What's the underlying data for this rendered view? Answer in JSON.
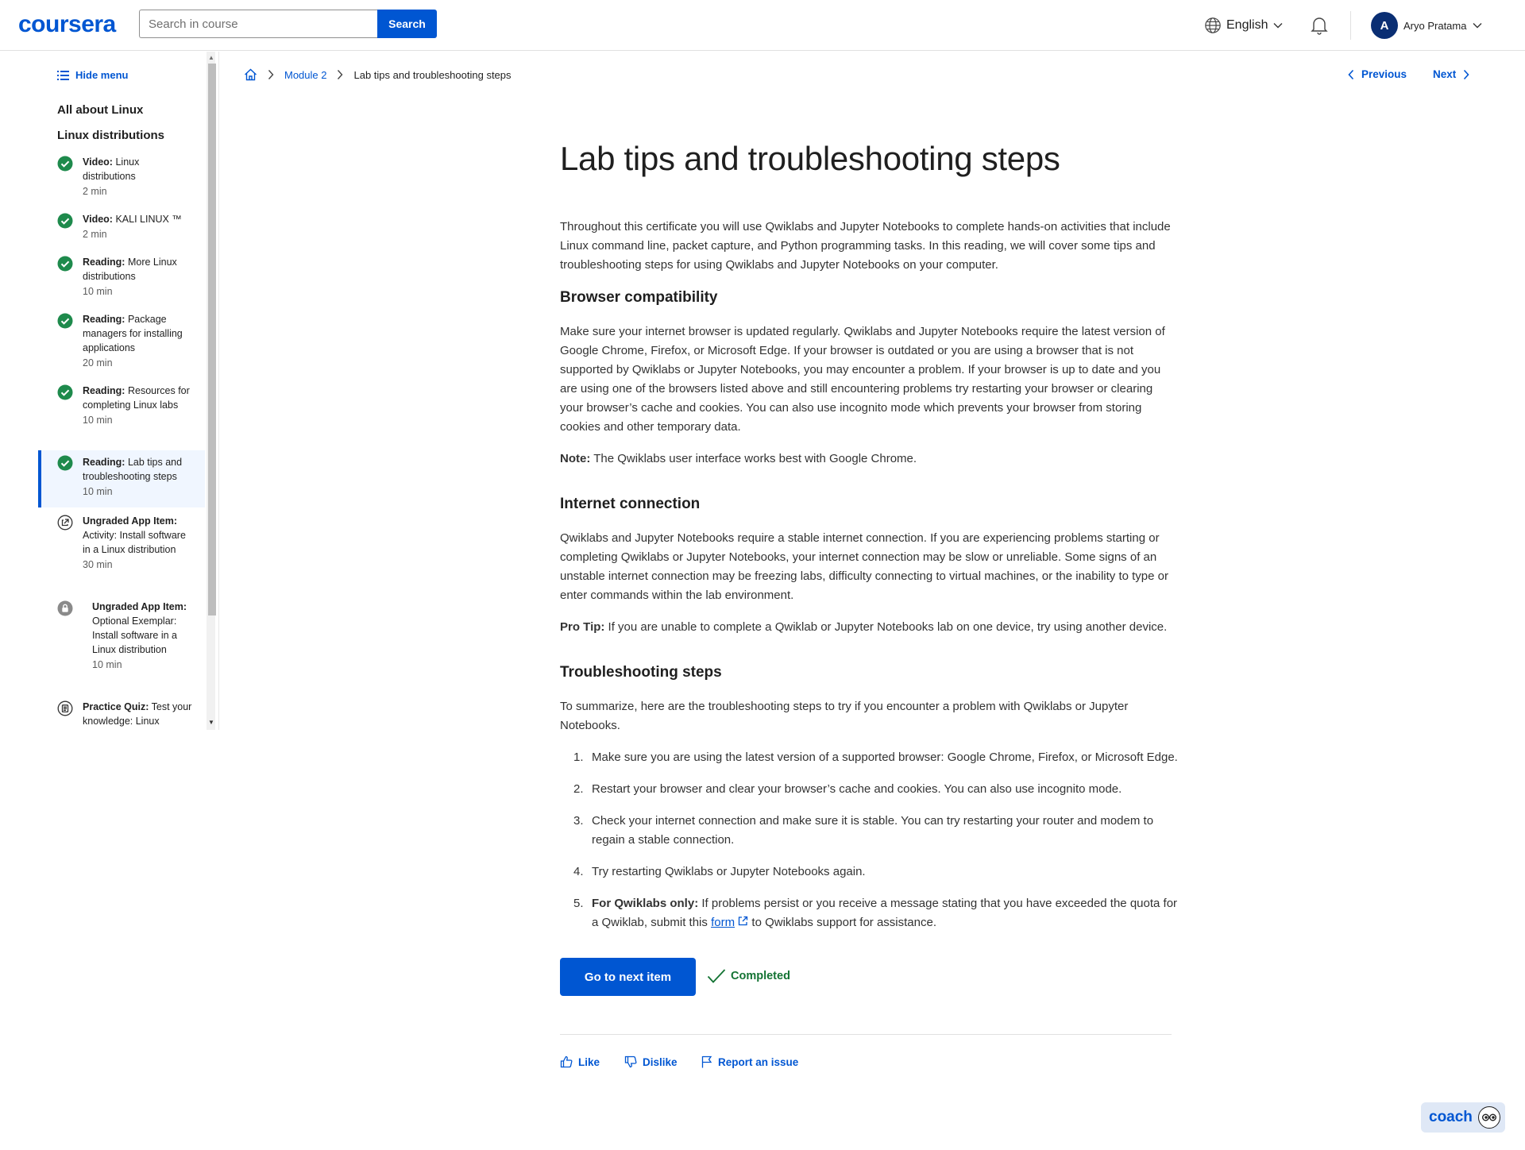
{
  "header": {
    "logo": "coursera",
    "search_placeholder": "Search in course",
    "search_button": "Search",
    "language": "English",
    "user_initial": "A",
    "user_name": "Aryo Pratama"
  },
  "sidebar": {
    "hide_menu": "Hide menu",
    "lesson_titles": [
      "All about Linux",
      "Linux distributions"
    ],
    "items": [
      {
        "type": "Video:",
        "name": "Linux distributions",
        "duration": "2 min",
        "status": "completed"
      },
      {
        "type": "Video:",
        "name": "KALI LINUX ™",
        "duration": "2 min",
        "status": "completed"
      },
      {
        "type": "Reading:",
        "name": "More Linux distributions",
        "duration": "10 min",
        "status": "completed"
      },
      {
        "type": "Reading:",
        "name": "Package managers for installing applications",
        "duration": "20 min",
        "status": "completed"
      },
      {
        "type": "Reading:",
        "name": "Resources for completing Linux labs",
        "duration": "10 min",
        "status": "completed"
      },
      {
        "type": "Reading:",
        "name": "Lab tips and troubleshooting steps",
        "duration": "10 min",
        "status": "completed",
        "active": true
      },
      {
        "type": "Ungraded App Item:",
        "name": "Activity: Install software in a Linux distribution",
        "duration": "30 min",
        "status": "app"
      },
      {
        "type": "Ungraded App Item:",
        "name": "Optional Exemplar: Install software in a Linux distribution",
        "duration": "10 min",
        "status": "locked"
      },
      {
        "type": "Practice Quiz:",
        "name": "Test your knowledge: Linux",
        "duration": "",
        "status": "quiz"
      }
    ]
  },
  "breadcrumb": {
    "module": "Module 2",
    "current": "Lab tips and troubleshooting steps"
  },
  "nav": {
    "previous": "Previous",
    "next": "Next"
  },
  "content": {
    "title": "Lab tips and troubleshooting steps",
    "intro": "Throughout this certificate you will use Qwiklabs and Jupyter Notebooks to complete hands-on activities that include Linux command line, packet capture, and Python programming tasks. In this reading, we will cover some tips and troubleshooting steps for using Qwiklabs and Jupyter Notebooks on your computer.",
    "browser_heading": "Browser compatibility",
    "browser_text": "Make sure your internet browser is updated regularly. Qwiklabs and Jupyter Notebooks require the latest version of Google Chrome, Firefox, or Microsoft Edge. If your browser is outdated or you are using a browser that is not supported by Qwiklabs or Jupyter Notebooks, you may encounter a problem. If your browser is up to date and you are using one of the browsers listed above and still encountering problems try restarting your browser or clearing your browser’s cache and cookies. You can also use incognito mode which prevents your browser from storing cookies and other temporary data.",
    "note_label": "Note:",
    "note_text": " The Qwiklabs user interface works best with Google Chrome.",
    "internet_heading": "Internet connection",
    "internet_text": "Qwiklabs and Jupyter Notebooks require a stable internet connection. If you are experiencing problems starting or completing Qwiklabs or Jupyter Notebooks, your internet connection may be slow or unreliable. Some signs of an unstable internet connection may be freezing labs, difficulty connecting to virtual machines, or the inability to type or enter commands within the lab environment.",
    "protip_label": "Pro Tip:",
    "protip_text": " If you are unable to complete a Qwiklab or Jupyter Notebooks lab on one device, try using another device.",
    "troubleshoot_heading": "Troubleshooting steps",
    "troubleshoot_intro": "To summarize, here are the troubleshooting steps to try if you encounter a problem with Qwiklabs or Jupyter Notebooks.",
    "steps": [
      {
        "num": "1.",
        "text": "Make sure you are using the latest version of a supported browser: Google Chrome, Firefox, or Microsoft Edge."
      },
      {
        "num": "2.",
        "text": "Restart your browser and clear your browser’s cache and cookies. You can also use incognito mode."
      },
      {
        "num": "3.",
        "text": "Check your internet connection and make sure it is stable. You can try restarting your router and modem to regain a stable connection."
      },
      {
        "num": "4.",
        "text": "Try restarting Qwiklabs or Jupyter Notebooks again."
      }
    ],
    "step5": {
      "num": "5.",
      "bold": "For Qwiklabs only:",
      "text_a": " If problems persist or you receive a message stating that you have exceeded the quota for a Qwiklab, submit this ",
      "link": "form",
      "text_b": " to Qwiklabs support for assistance."
    },
    "next_button": "Go to next item",
    "completed": "Completed",
    "like": "Like",
    "dislike": "Dislike",
    "report": "Report an issue"
  },
  "coach": "coach",
  "colors": {
    "brand": "#0056d2",
    "success": "#137333"
  }
}
